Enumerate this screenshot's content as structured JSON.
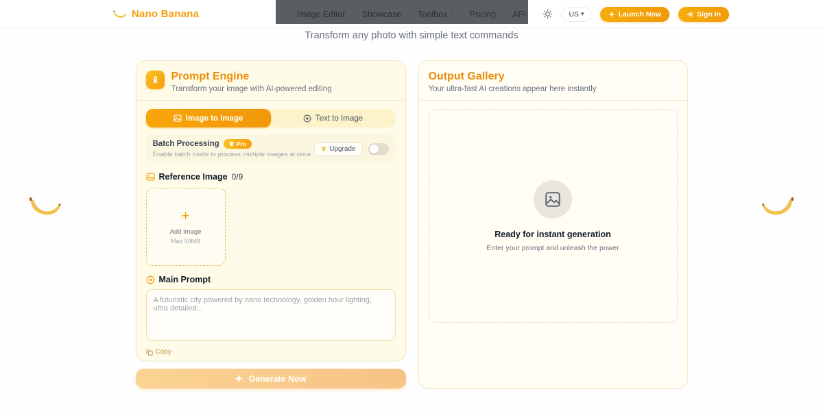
{
  "header": {
    "brand": "Nano Banana",
    "nav": [
      "Image Editor",
      "Showcase",
      "Toolbox",
      "Pricing",
      "API"
    ],
    "language": "US",
    "launch_label": "Launch Now",
    "signin_label": "Sign In"
  },
  "hero": {
    "subtitle": "Transform any photo with simple text commands"
  },
  "prompt_engine": {
    "title": "Prompt Engine",
    "subtitle": "Transform your image with AI-powered editing",
    "tabs": [
      {
        "label": "Image to Image"
      },
      {
        "label": "Text to Image"
      }
    ],
    "batch": {
      "title": "Batch Processing",
      "badge": "Pro",
      "description": "Enable batch mode to process multiple images at once",
      "upgrade_label": "Upgrade"
    },
    "reference": {
      "label": "Reference Image",
      "count": "0/9",
      "add_label": "Add Image",
      "max_label": "Max 50MB"
    },
    "prompt": {
      "label": "Main Prompt",
      "placeholder": "A futuristic city powered by nano technology, golden hour lighting, ultra detailed...",
      "copy_label": "Copy"
    },
    "generate_label": "Generate Now"
  },
  "output_gallery": {
    "title": "Output Gallery",
    "subtitle": "Your ultra-fast AI creations appear here instantly",
    "empty_title": "Ready for instant generation",
    "empty_subtitle": "Enter your prompt and unleash the power"
  },
  "icons": {
    "crown": "♛",
    "plus": "+",
    "chevron_down": "▾"
  },
  "colors": {
    "brand_orange": "#f59e0b",
    "card_background": "#fefce8",
    "card_border": "#f3e7bd",
    "dark_band": "#43484b"
  }
}
